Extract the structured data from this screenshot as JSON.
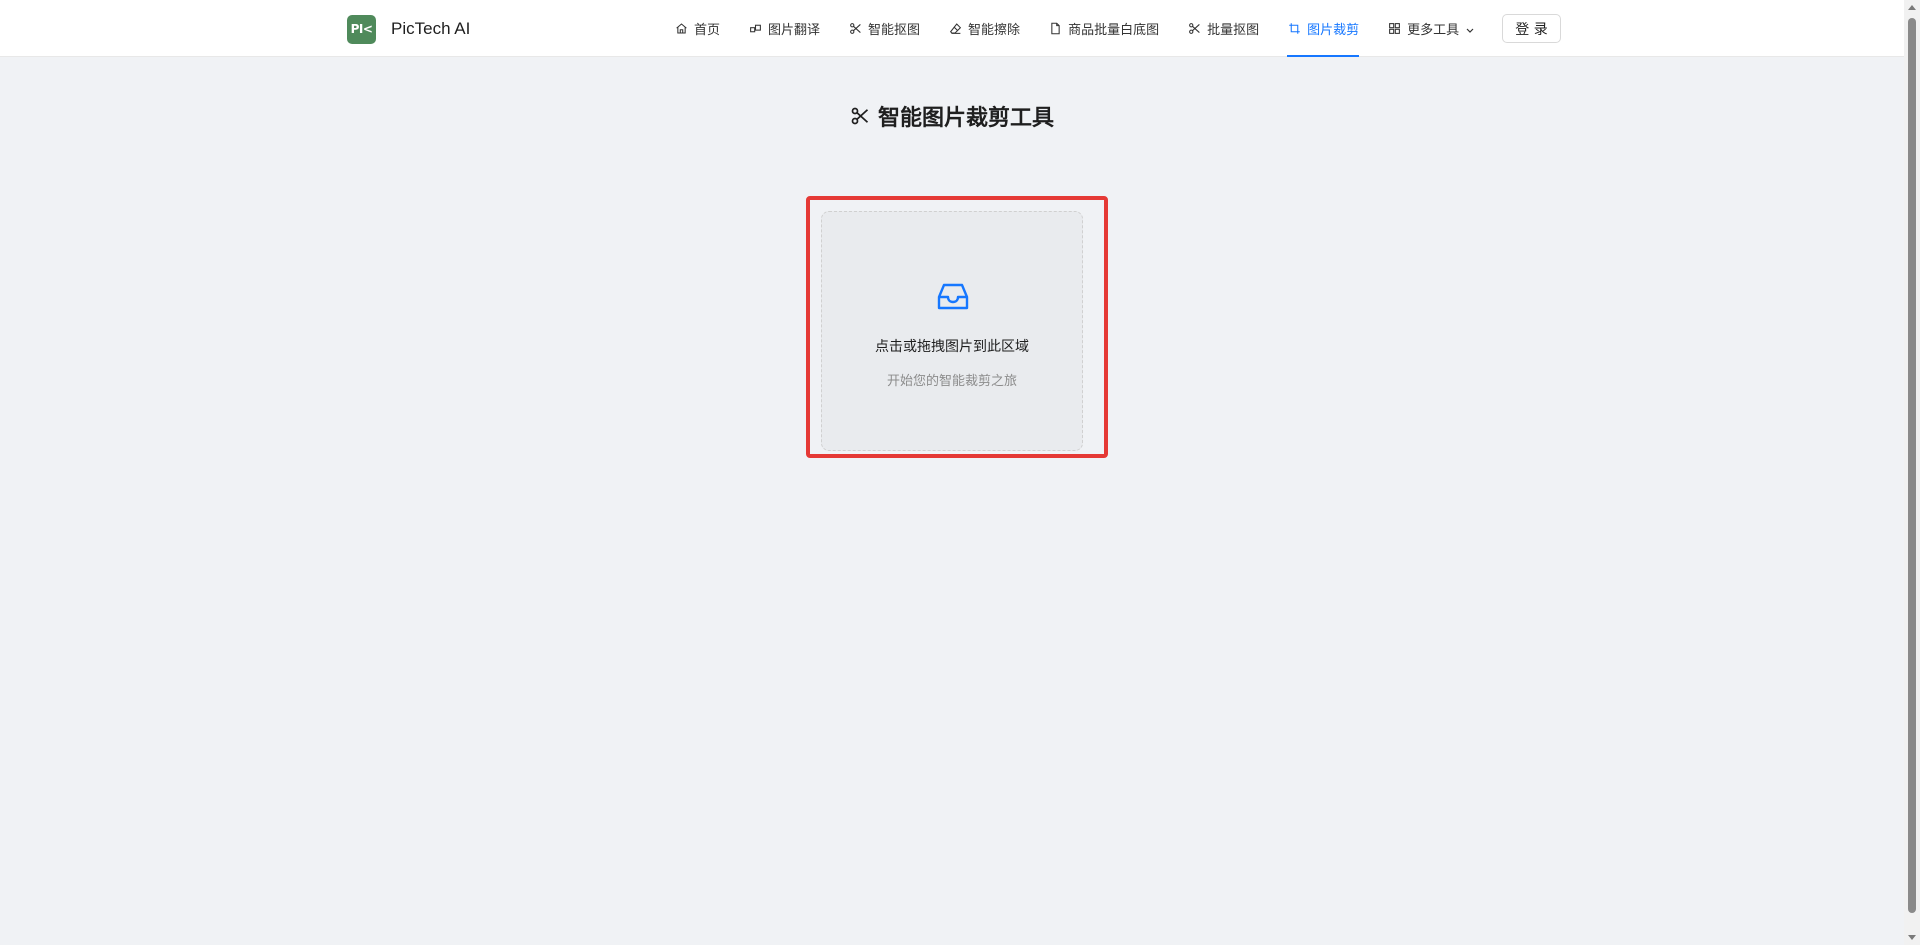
{
  "brand": {
    "logo_text": "PI<",
    "name": "PicTech AI"
  },
  "nav": {
    "items": [
      {
        "label": "首页",
        "icon": "home-icon"
      },
      {
        "label": "图片翻译",
        "icon": "translate-icon"
      },
      {
        "label": "智能抠图",
        "icon": "scissors-icon"
      },
      {
        "label": "智能擦除",
        "icon": "eraser-icon"
      },
      {
        "label": "商品批量白底图",
        "icon": "document-icon"
      },
      {
        "label": "批量抠图",
        "icon": "scissors-icon"
      },
      {
        "label": "图片裁剪",
        "icon": "crop-icon",
        "active": true
      },
      {
        "label": "更多工具",
        "icon": "grid-icon",
        "dropdown": true
      }
    ],
    "login_label": "登 录"
  },
  "colors": {
    "accent": "#1677ff",
    "brand_green": "#4f8a5b",
    "highlight_red": "#e53935",
    "background": "#f0f2f5"
  },
  "main": {
    "title": "智能图片裁剪工具",
    "title_icon": "scissors-icon",
    "upload": {
      "icon": "inbox-icon",
      "text": "点击或拖拽图片到此区域",
      "hint": "开始您的智能裁剪之旅"
    }
  }
}
